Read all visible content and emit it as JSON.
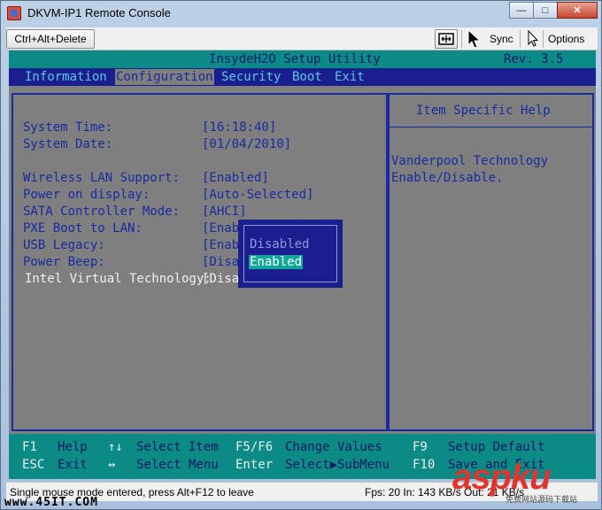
{
  "window": {
    "title": "DKVM-IP1 Remote Console",
    "minimize_glyph": "—",
    "maximize_glyph": "□",
    "close_glyph": "✕"
  },
  "toolbar": {
    "ctrl_alt_delete": "Ctrl+Alt+Delete",
    "sync": "Sync",
    "options": "Options"
  },
  "bios": {
    "title": "InsydeH2O Setup Utility",
    "revision": "Rev. 3.5",
    "menu": [
      "Information",
      "Configuration",
      "Security",
      "Boot",
      "Exit"
    ],
    "active_menu": "Configuration",
    "rows": [
      {
        "label": "System Time:",
        "value": "[16:18:40]"
      },
      {
        "label": "System Date:",
        "value": "[01/04/2010]"
      },
      {
        "label": "Wireless LAN Support:",
        "value": "[Enabled]"
      },
      {
        "label": "Power on display:",
        "value": "[Auto-Selected]"
      },
      {
        "label": "SATA Controller Mode:",
        "value": "[AHCI]"
      },
      {
        "label": "PXE Boot to LAN:",
        "value": "[Enab"
      },
      {
        "label": "USB Legacy:",
        "value": "[Enab"
      },
      {
        "label": "Power Beep:",
        "value": "[Disa"
      },
      {
        "label": "Intel Virtual Technology:",
        "value": "[Disa"
      }
    ],
    "help_title": "Item Specific Help",
    "help_lines": [
      "Vanderpool Technology",
      "Enable/Disable."
    ],
    "popup_options": [
      "Disabled",
      "Enabled"
    ],
    "popup_selected": "Enabled",
    "footer": [
      {
        "key": "F1",
        "desc": "Help"
      },
      {
        "key": "↑↓",
        "desc": "Select Item"
      },
      {
        "key": "F5/F6",
        "desc": "Change Values"
      },
      {
        "key": "F9",
        "desc": "Setup Default"
      },
      {
        "key": "ESC",
        "desc": "Exit"
      },
      {
        "key": "↔",
        "desc": "Select Menu"
      },
      {
        "key": "Enter",
        "desc": "Select▶SubMenu"
      },
      {
        "key": "F10",
        "desc": "Save and Exit"
      }
    ]
  },
  "status": {
    "left": "Single mouse mode entered, press Alt+F12 to leave",
    "right": "Fps: 20 In: 143 KB/s Out: 21 KB/s"
  },
  "watermarks": {
    "left": "www.45IT.COM",
    "right": "aspku",
    "right_sub": "免费网站源码下载站"
  },
  "icons": {
    "app": "dkvm-app-icon",
    "fullscreen": "fullscreen-icon",
    "cursor_sync": "mouse-cursor-icon",
    "cursor_plain": "arrow-cursor-icon"
  }
}
